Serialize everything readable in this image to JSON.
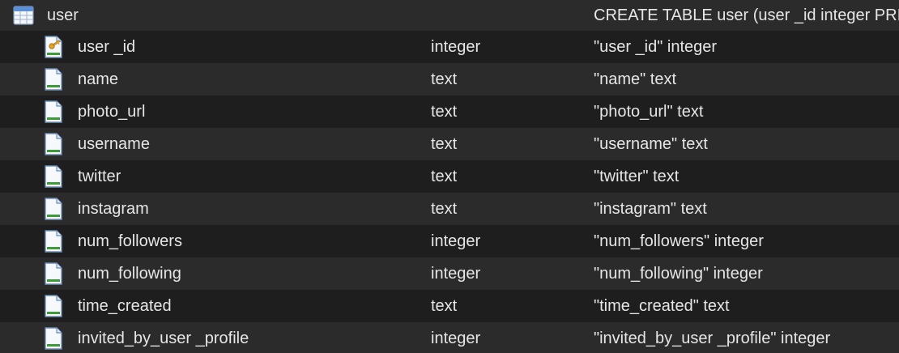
{
  "table": {
    "name": "user",
    "schema": "CREATE TABLE user (user _id integer PRIMARY KEY",
    "icon": "table-icon"
  },
  "fields": [
    {
      "name": "user _id",
      "type": "integer",
      "schema": "\"user _id\" integer",
      "icon": "primary-key-field-icon"
    },
    {
      "name": "name",
      "type": "text",
      "schema": "\"name\" text",
      "icon": "field-icon"
    },
    {
      "name": "photo_url",
      "type": "text",
      "schema": "\"photo_url\" text",
      "icon": "field-icon"
    },
    {
      "name": "username",
      "type": "text",
      "schema": "\"username\" text",
      "icon": "field-icon"
    },
    {
      "name": "twitter",
      "type": "text",
      "schema": "\"twitter\" text",
      "icon": "field-icon"
    },
    {
      "name": "instagram",
      "type": "text",
      "schema": "\"instagram\" text",
      "icon": "field-icon"
    },
    {
      "name": "num_followers",
      "type": "integer",
      "schema": "\"num_followers\" integer",
      "icon": "field-icon"
    },
    {
      "name": "num_following",
      "type": "integer",
      "schema": "\"num_following\" integer",
      "icon": "field-icon"
    },
    {
      "name": "time_created",
      "type": "text",
      "schema": "\"time_created\" text",
      "icon": "field-icon"
    },
    {
      "name": "invited_by_user _profile",
      "type": "integer",
      "schema": "\"invited_by_user _profile\" integer",
      "icon": "field-icon"
    }
  ],
  "colors": {
    "background": "#1e1e1e",
    "stripe": "#2b2b2b",
    "text": "#e6e6e6"
  }
}
